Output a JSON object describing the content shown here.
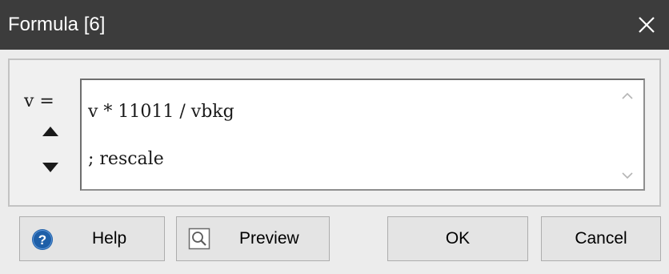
{
  "window": {
    "title": "Formula [6]"
  },
  "formula": {
    "variable_label": "v =",
    "text": "v * 11011 / vbkg\n; rescale"
  },
  "icons": {
    "close": "close-icon",
    "move_up": "triangle-up-icon",
    "move_down": "triangle-down-icon",
    "help": "question-circle-icon",
    "preview": "magnifier-icon"
  },
  "buttons": {
    "help_label": "Help",
    "preview_label": "Preview",
    "ok_label": "OK",
    "cancel_label": "Cancel"
  },
  "colors": {
    "titlebar": "#3c3c3c",
    "dialog_bg": "#ececec",
    "help_icon": "#1e5fa8"
  }
}
